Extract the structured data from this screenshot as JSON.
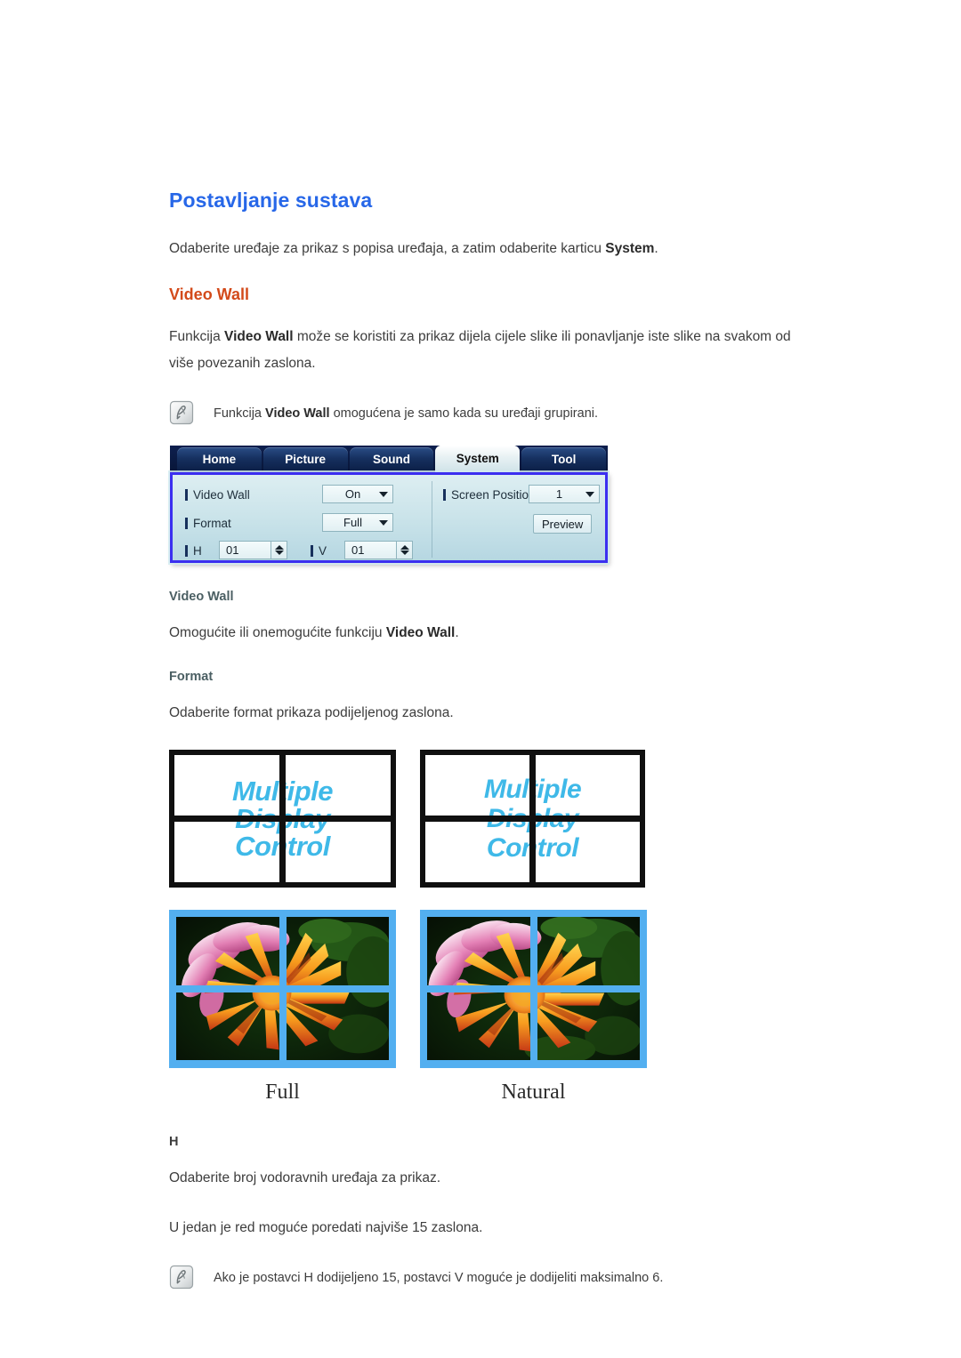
{
  "section": {
    "title": "Postavljanje sustava",
    "intro_prefix": "Odaberite uređaje za prikaz s popisa uređaja, a zatim odaberite karticu ",
    "intro_bold": "System",
    "intro_suffix": "."
  },
  "videowall": {
    "heading": "Video Wall",
    "desc_prefix": "Funkcija ",
    "desc_bold": "Video Wall",
    "desc_suffix": " može se koristiti za prikaz dijela cijele slike ili ponavljanje iste slike na svakom od više povezanih zaslona.",
    "note_prefix": "Funkcija ",
    "note_bold": "Video Wall",
    "note_suffix": " omogućena je samo kada su uređaji grupirani.",
    "note_icon": "note-pen-icon"
  },
  "osd": {
    "tabs": [
      {
        "label": "Home",
        "active": false
      },
      {
        "label": "Picture",
        "active": false
      },
      {
        "label": "Sound",
        "active": false
      },
      {
        "label": "System",
        "active": true
      },
      {
        "label": "Tool",
        "active": false
      }
    ],
    "rows": {
      "video_wall_label": "Video Wall",
      "video_wall_value": "On",
      "format_label": "Format",
      "format_value": "Full",
      "h_label": "H",
      "h_value": "01",
      "v_label": "V",
      "v_value": "01",
      "screen_position_label": "Screen Position",
      "screen_position_value": "1",
      "preview_label": "Preview"
    },
    "colors": {
      "tab_bar": "#0b1e45",
      "panel_border": "#3b2ff0",
      "panel_fill": "#cbe4ea"
    }
  },
  "items": [
    {
      "title": "Video Wall",
      "desc_prefix": "Omogućite ili onemogućite funkciju ",
      "desc_bold": "Video Wall",
      "desc_suffix": "."
    },
    {
      "title": "Format",
      "desc_prefix": "Odaberite format prikaza podijeljenog zaslona.",
      "desc_bold": "",
      "desc_suffix": ""
    }
  ],
  "figure": {
    "screen_text_lines": [
      "Multiple",
      "Display",
      "Control"
    ],
    "captions": [
      "Full",
      "Natural"
    ],
    "bezel_color": "#53aff0",
    "text_color": "#3fb9e8"
  },
  "h_section": {
    "title": "H",
    "line1": "Odaberite broj vodoravnih uređaja za prikaz.",
    "line2": "U jedan je red moguće poredati najviše 15 zaslona.",
    "note": "Ako je postavci H dodijeljeno 15, postavci V moguće je dodijeliti maksimalno 6.",
    "note_icon": "note-pen-icon"
  }
}
